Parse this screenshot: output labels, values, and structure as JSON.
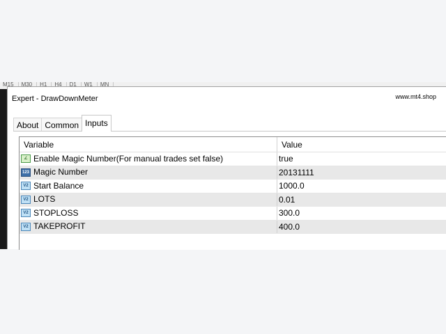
{
  "background_tabs": [
    "M15",
    "M30",
    "H1",
    "H4",
    "D1",
    "W1",
    "MN"
  ],
  "dialog": {
    "title": "Expert - DrawDownMeter",
    "watermark": "www.mt4.shop"
  },
  "tabs": [
    {
      "label": "About",
      "active": false
    },
    {
      "label": "Common",
      "active": false
    },
    {
      "label": "Inputs",
      "active": true
    }
  ],
  "grid": {
    "headers": {
      "variable": "Variable",
      "value": "Value"
    },
    "rows": [
      {
        "variable": "Enable Magic Number(For manual trades set false)",
        "value": "true",
        "icon": "bool-param-icon",
        "icon_glyph": "∠"
      },
      {
        "variable": "Magic Number",
        "value": "20131111",
        "icon": "int-param-icon",
        "icon_glyph": "123"
      },
      {
        "variable": "Start Balance",
        "value": "1000.0",
        "icon": "double-param-icon",
        "icon_glyph": "V2"
      },
      {
        "variable": "LOTS",
        "value": "0.01",
        "icon": "double-param-icon",
        "icon_glyph": "V2"
      },
      {
        "variable": "STOPLOSS",
        "value": "300.0",
        "icon": "double-param-icon",
        "icon_glyph": "V2"
      },
      {
        "variable": "TAKEPROFIT",
        "value": "400.0",
        "icon": "double-param-icon",
        "icon_glyph": "V2"
      }
    ]
  },
  "colors": {
    "row_shaded": "#e8e8e8",
    "icon_blue": "#bfe0f5",
    "icon_int": "#3d6fa8"
  }
}
